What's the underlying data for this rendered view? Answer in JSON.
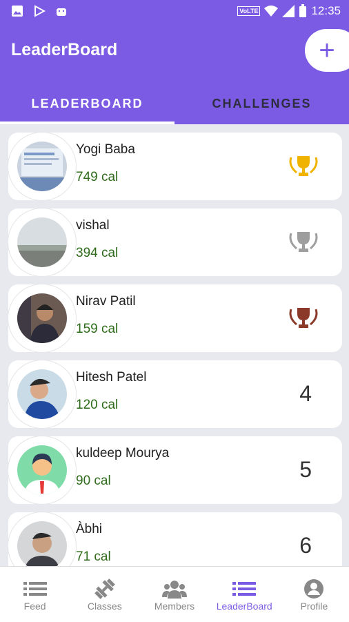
{
  "status": {
    "volte": "VoLTE",
    "time": "12:35"
  },
  "app": {
    "title": "LeaderBoard",
    "add_label": "+"
  },
  "tabs": [
    {
      "label": "LEADERBOARD",
      "active": true
    },
    {
      "label": "CHALLENGES",
      "active": false
    }
  ],
  "leaders": [
    {
      "name": "Yogi Baba",
      "cal": "749 cal",
      "trophy": "gold-trophy-icon",
      "rank": ""
    },
    {
      "name": "vishal",
      "cal": "394 cal",
      "trophy": "silver-trophy-icon",
      "rank": ""
    },
    {
      "name": "Nirav Patil",
      "cal": "159 cal",
      "trophy": "bronze-trophy-icon",
      "rank": ""
    },
    {
      "name": "Hitesh Patel",
      "cal": "120 cal",
      "trophy": "",
      "rank": "4"
    },
    {
      "name": "kuldeep Mourya",
      "cal": "90 cal",
      "trophy": "",
      "rank": "5"
    },
    {
      "name": "Àbhi",
      "cal": "71 cal",
      "trophy": "",
      "rank": "6"
    }
  ],
  "nav": [
    {
      "label": "Feed",
      "icon": "list-icon"
    },
    {
      "label": "Classes",
      "icon": "dumbbell-icon"
    },
    {
      "label": "Members",
      "icon": "group-icon"
    },
    {
      "label": "LeaderBoard",
      "icon": "leaderboard-icon"
    },
    {
      "label": "Profile",
      "icon": "profile-icon"
    }
  ],
  "colors": {
    "primary": "#7b5be3",
    "calorie": "#2e6b1a",
    "gold": "#f0b400",
    "silver": "#9e9e9e",
    "bronze": "#8b3a2a"
  }
}
